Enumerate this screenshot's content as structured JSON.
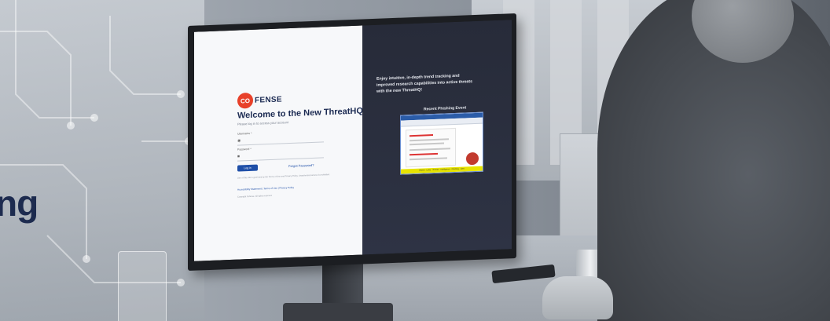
{
  "headline": "ng",
  "login": {
    "logo_mark": "CO",
    "logo_text": "FENSE",
    "title": "Welcome to the New ThreatHQ!",
    "subtitle": "Please log in to access your account",
    "username_label": "Username *",
    "password_label": "Password *",
    "login_button": "Log in",
    "forgot_link": "Forgot Password?",
    "legal_text": "Use of this site is governed by the Terms of Use and Privacy Policy. Unauthorized access is prohibited.",
    "links": "Accessibility Statement | Terms of Use | Privacy Policy",
    "copyright": "Copyright Cofense. All rights reserved."
  },
  "promo": {
    "text": "Enjoy intuitive, in-depth trend tracking and improved research capabilities into active threats with the new ThreatHQ!",
    "screenshot_title": "Recent Phishing Event",
    "banner": "Report · Links · Threats · Intelligence · Phishing · Alert"
  },
  "icons": [
    "user-icon",
    "lock-icon",
    "logo-mark"
  ],
  "colors": {
    "navy": "#1b2a52",
    "brand_red": "#e8412a",
    "button_blue": "#1f4fa8",
    "promo_bg": "#272b39",
    "highlight_yellow": "#e7e300"
  }
}
